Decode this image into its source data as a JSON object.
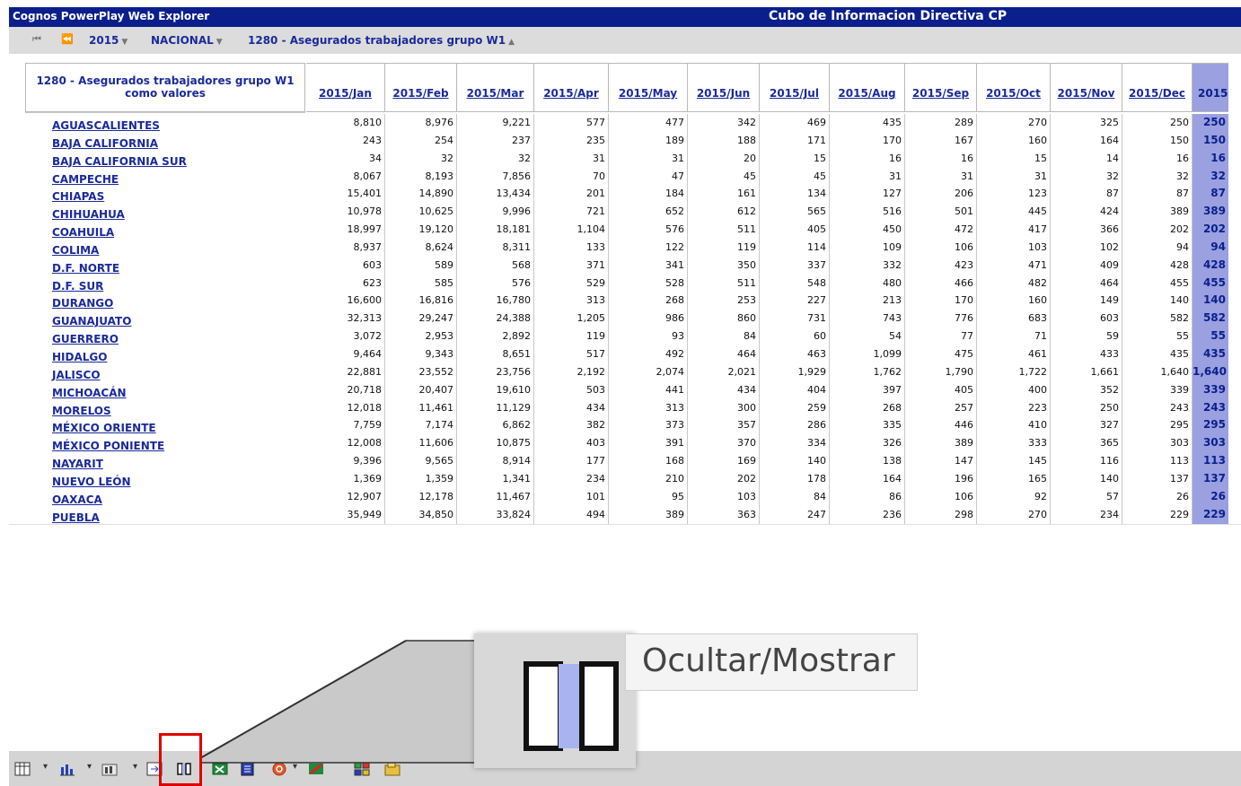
{
  "titlebar": {
    "app_title": "Cognos PowerPlay Web Explorer",
    "cube_title": "Cubo de Informacion Directiva CP"
  },
  "navbar": {
    "first_icon": "first-page-icon",
    "prev_icon": "previous-page-icon",
    "year": "2015",
    "region": "NACIONAL",
    "measure": "1280 - Asegurados trabajadores grupo W1"
  },
  "crosstab": {
    "corner_line1": "1280 - Asegurados trabajadores grupo W1",
    "corner_line2": "como valores",
    "columns": [
      "2015/Jan",
      "2015/Feb",
      "2015/Mar",
      "2015/Apr",
      "2015/May",
      "2015/Jun",
      "2015/Jul",
      "2015/Aug",
      "2015/Sep",
      "2015/Oct",
      "2015/Nov",
      "2015/Dec",
      "2015"
    ],
    "rows": [
      {
        "label": "AGUASCALIENTES",
        "values": [
          "8,810",
          "8,976",
          "9,221",
          "577",
          "477",
          "342",
          "469",
          "435",
          "289",
          "270",
          "325",
          "250",
          "250"
        ]
      },
      {
        "label": "BAJA CALIFORNIA",
        "values": [
          "243",
          "254",
          "237",
          "235",
          "189",
          "188",
          "171",
          "170",
          "167",
          "160",
          "164",
          "150",
          "150"
        ]
      },
      {
        "label": "BAJA CALIFORNIA SUR",
        "values": [
          "34",
          "32",
          "32",
          "31",
          "31",
          "20",
          "15",
          "16",
          "16",
          "15",
          "14",
          "16",
          "16"
        ]
      },
      {
        "label": "CAMPECHE",
        "values": [
          "8,067",
          "8,193",
          "7,856",
          "70",
          "47",
          "45",
          "45",
          "31",
          "31",
          "31",
          "32",
          "32",
          "32"
        ]
      },
      {
        "label": "CHIAPAS",
        "values": [
          "15,401",
          "14,890",
          "13,434",
          "201",
          "184",
          "161",
          "134",
          "127",
          "206",
          "123",
          "87",
          "87",
          "87"
        ]
      },
      {
        "label": "CHIHUAHUA",
        "values": [
          "10,978",
          "10,625",
          "9,996",
          "721",
          "652",
          "612",
          "565",
          "516",
          "501",
          "445",
          "424",
          "389",
          "389"
        ]
      },
      {
        "label": "COAHUILA",
        "values": [
          "18,997",
          "19,120",
          "18,181",
          "1,104",
          "576",
          "511",
          "405",
          "450",
          "472",
          "417",
          "366",
          "202",
          "202"
        ]
      },
      {
        "label": "COLIMA",
        "values": [
          "8,937",
          "8,624",
          "8,311",
          "133",
          "122",
          "119",
          "114",
          "109",
          "106",
          "103",
          "102",
          "94",
          "94"
        ]
      },
      {
        "label": "D.F. NORTE",
        "values": [
          "603",
          "589",
          "568",
          "371",
          "341",
          "350",
          "337",
          "332",
          "423",
          "471",
          "409",
          "428",
          "428"
        ]
      },
      {
        "label": "D.F. SUR",
        "values": [
          "623",
          "585",
          "576",
          "529",
          "528",
          "511",
          "548",
          "480",
          "466",
          "482",
          "464",
          "455",
          "455"
        ]
      },
      {
        "label": "DURANGO",
        "values": [
          "16,600",
          "16,816",
          "16,780",
          "313",
          "268",
          "253",
          "227",
          "213",
          "170",
          "160",
          "149",
          "140",
          "140"
        ]
      },
      {
        "label": "GUANAJUATO",
        "values": [
          "32,313",
          "29,247",
          "24,388",
          "1,205",
          "986",
          "860",
          "731",
          "743",
          "776",
          "683",
          "603",
          "582",
          "582"
        ]
      },
      {
        "label": "GUERRERO",
        "values": [
          "3,072",
          "2,953",
          "2,892",
          "119",
          "93",
          "84",
          "60",
          "54",
          "77",
          "71",
          "59",
          "55",
          "55"
        ]
      },
      {
        "label": "HIDALGO",
        "values": [
          "9,464",
          "9,343",
          "8,651",
          "517",
          "492",
          "464",
          "463",
          "1,099",
          "475",
          "461",
          "433",
          "435",
          "435"
        ]
      },
      {
        "label": "JALISCO",
        "values": [
          "22,881",
          "23,552",
          "23,756",
          "2,192",
          "2,074",
          "2,021",
          "1,929",
          "1,762",
          "1,790",
          "1,722",
          "1,661",
          "1,640",
          "1,640"
        ]
      },
      {
        "label": "MICHOACÁN",
        "values": [
          "20,718",
          "20,407",
          "19,610",
          "503",
          "441",
          "434",
          "404",
          "397",
          "405",
          "400",
          "352",
          "339",
          "339"
        ]
      },
      {
        "label": "MORELOS",
        "values": [
          "12,018",
          "11,461",
          "11,129",
          "434",
          "313",
          "300",
          "259",
          "268",
          "257",
          "223",
          "250",
          "243",
          "243"
        ]
      },
      {
        "label": "MÉXICO ORIENTE",
        "values": [
          "7,759",
          "7,174",
          "6,862",
          "382",
          "373",
          "357",
          "286",
          "335",
          "446",
          "410",
          "327",
          "295",
          "295"
        ]
      },
      {
        "label": "MÉXICO PONIENTE",
        "values": [
          "12,008",
          "11,606",
          "10,875",
          "403",
          "391",
          "370",
          "334",
          "326",
          "389",
          "333",
          "365",
          "303",
          "303"
        ]
      },
      {
        "label": "NAYARIT",
        "values": [
          "9,396",
          "9,565",
          "8,914",
          "177",
          "168",
          "169",
          "140",
          "138",
          "147",
          "145",
          "116",
          "113",
          "113"
        ]
      },
      {
        "label": "NUEVO LEÓN",
        "values": [
          "1,369",
          "1,359",
          "1,341",
          "234",
          "210",
          "202",
          "178",
          "164",
          "196",
          "165",
          "140",
          "137",
          "137"
        ]
      },
      {
        "label": "OAXACA",
        "values": [
          "12,907",
          "12,178",
          "11,467",
          "101",
          "95",
          "103",
          "84",
          "86",
          "106",
          "92",
          "57",
          "26",
          "26"
        ]
      },
      {
        "label": "PUEBLA",
        "values": [
          "35,949",
          "34,850",
          "33,824",
          "494",
          "389",
          "363",
          "247",
          "236",
          "298",
          "270",
          "234",
          "229",
          "229"
        ]
      }
    ]
  },
  "toolbar": {
    "icons": [
      "crosstab-icon",
      "bar-chart-icon",
      "indicator-chart-icon",
      "swap-rows-columns-icon",
      "hide-show-icon",
      "export-excel-icon",
      "export-pdf-icon",
      "help-icon",
      "explain-icon",
      "bookmark-icon",
      "save-icon"
    ]
  },
  "tooltip": {
    "label": "Ocultar/Mostrar"
  },
  "colors": {
    "title_blue": "#0b1f8c",
    "link_blue": "#1a2a9a",
    "highlight_red": "#e00000",
    "total_col": "#9aa0e0"
  }
}
